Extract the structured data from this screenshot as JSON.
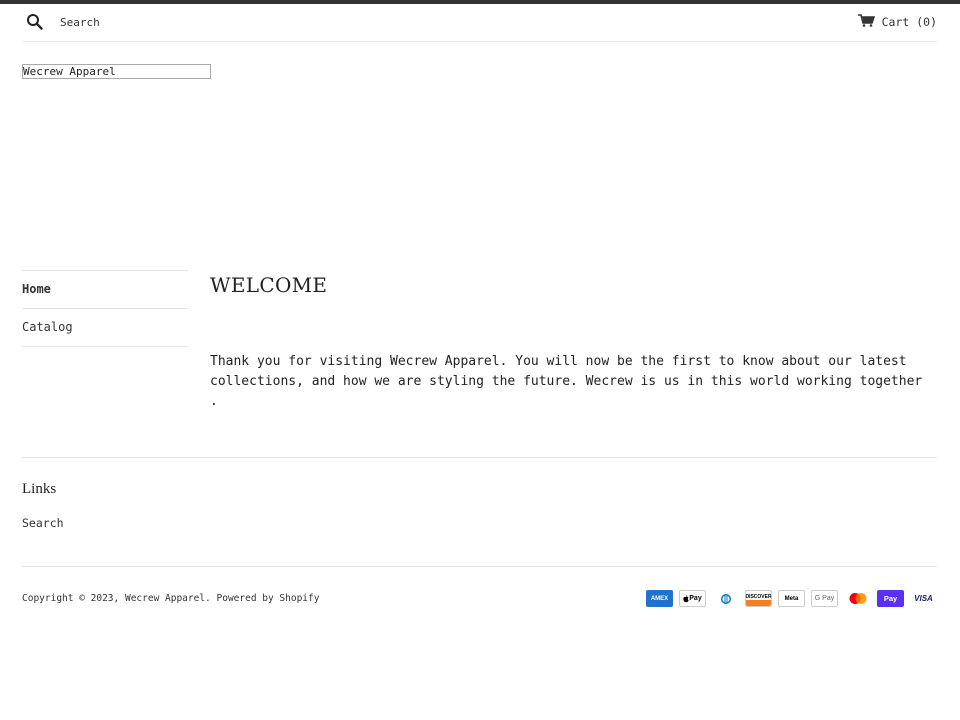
{
  "header": {
    "search_placeholder": "Search",
    "cart_label": "Cart",
    "cart_count": "(0)"
  },
  "logo": {
    "text": "Wecrew Apparel"
  },
  "sidenav": {
    "items": [
      {
        "label": "Home",
        "active": true
      },
      {
        "label": "Catalog",
        "active": false
      }
    ]
  },
  "main": {
    "title": "WELCOME",
    "body": "Thank you for visiting Wecrew Apparel. You will now be the first to know about our latest collections, and how we are styling the future. Wecrew is us in this world working together ."
  },
  "footer": {
    "links_title": "Links",
    "links": [
      {
        "label": "Search"
      }
    ],
    "copyright_prefix": "Copyright © 2023,",
    "store_name": "Wecrew Apparel",
    "powered_by": "Powered by Shopify",
    "payment_icons": [
      {
        "name": "american-express-icon",
        "label": "AMEX",
        "bg": "#1f72cd",
        "fg": "#ffffff"
      },
      {
        "name": "apple-pay-icon",
        "label": "Pay",
        "bg": "#ffffff",
        "fg": "#000000"
      },
      {
        "name": "diners-club-icon",
        "label": "D",
        "bg": "#ffffff",
        "fg": "#0079be"
      },
      {
        "name": "discover-icon",
        "label": "DISCOVER",
        "bg": "#ffffff",
        "fg": "#000000"
      },
      {
        "name": "meta-pay-icon",
        "label": "Meta",
        "bg": "#ffffff",
        "fg": "#000000"
      },
      {
        "name": "google-pay-icon",
        "label": "G Pay",
        "bg": "#ffffff",
        "fg": "#5f6368"
      },
      {
        "name": "mastercard-icon",
        "label": "",
        "bg": "#ffffff",
        "fg": "#000000"
      },
      {
        "name": "shop-pay-icon",
        "label": "Pay",
        "bg": "#5a31f4",
        "fg": "#ffffff"
      },
      {
        "name": "visa-icon",
        "label": "VISA",
        "bg": "#ffffff",
        "fg": "#1a1f71"
      }
    ]
  }
}
